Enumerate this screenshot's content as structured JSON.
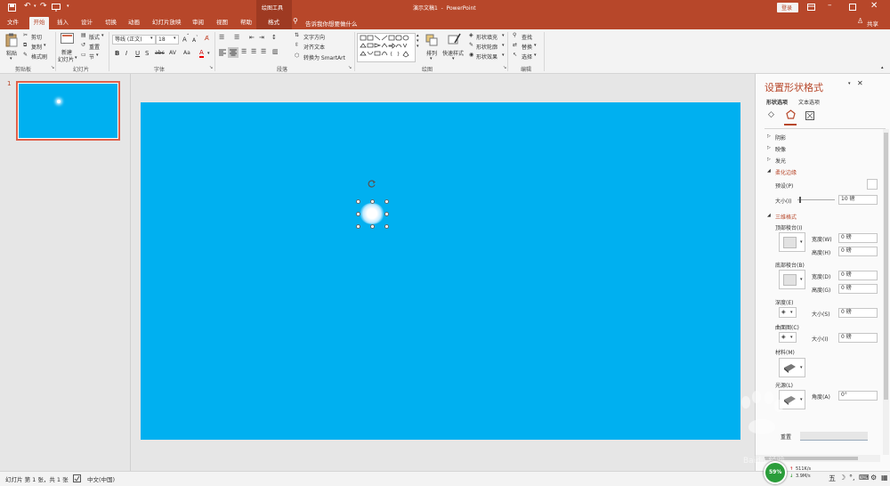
{
  "title_bar": {
    "contextual_tab_group": "绘图工具",
    "document_title": "演示文稿1  -  PowerPoint",
    "login_button": "登录"
  },
  "tabs": [
    {
      "label": "文件"
    },
    {
      "label": "开始"
    },
    {
      "label": "插入"
    },
    {
      "label": "设计"
    },
    {
      "label": "切换"
    },
    {
      "label": "动画"
    },
    {
      "label": "幻灯片放映"
    },
    {
      "label": "审阅"
    },
    {
      "label": "视图"
    },
    {
      "label": "帮助"
    },
    {
      "label": "格式"
    }
  ],
  "tell_me": "告诉我你想要做什么",
  "share": "共享",
  "ribbon": {
    "clipboard": {
      "paste": "粘贴",
      "cut": "剪切",
      "copy": "复制",
      "format_painter": "格式刷",
      "group": "剪贴板"
    },
    "slides": {
      "new_slide": "新建",
      "new_slide2": "幻灯片",
      "layout": "版式",
      "reset": "重置",
      "section": "节",
      "group": "幻灯片"
    },
    "font": {
      "font_name": "等线 (正文)",
      "font_size": "18",
      "bold": "B",
      "italic": "I",
      "underline": "U",
      "shadow": "S",
      "strike": "abc",
      "spacing": "AV",
      "case": "Aa",
      "group": "字体"
    },
    "paragraph": {
      "text_direction": "文字方向",
      "align_text": "对齐文本",
      "smartart": "转换为 SmartArt",
      "group": "段落"
    },
    "drawing": {
      "arrange": "排列",
      "quick_styles": "快速样式",
      "shape_fill": "形状填充",
      "shape_outline": "形状轮廓",
      "shape_effects": "形状效果",
      "group": "绘图"
    },
    "editing": {
      "find": "查找",
      "replace": "替换",
      "select": "选择",
      "group": "编辑"
    }
  },
  "thumbnail": {
    "number": "1"
  },
  "format_pane": {
    "title": "设置形状格式",
    "tab_shape": "形状选项",
    "tab_text": "文本选项",
    "sections": {
      "shadow": "阴影",
      "reflection": "映像",
      "glow": "发光",
      "soft_edges": "柔化边缘",
      "three_d": "三维格式"
    },
    "soft_edges": {
      "preset": "预设(P)",
      "size": "大小(I)",
      "size_value": "10 磅"
    },
    "three_d": {
      "top_bevel": "顶部棱台(I)",
      "bottom_bevel": "底部棱台(B)",
      "width_w": "宽度(W)",
      "height_h": "高度(H)",
      "width_d": "宽度(D)",
      "height_g": "高度(G)",
      "width_value": "0 磅",
      "height_value": "0 磅",
      "width2_value": "0 磅",
      "height2_value": "0 磅",
      "depth": "深度(E)",
      "depth_size": "大小(S)",
      "depth_value": "0 磅",
      "contour": "曲面图(C)",
      "contour_size": "大小(I)",
      "contour_value": "0 磅",
      "material": "材料(M)",
      "lighting": "光源(L)",
      "angle": "角度(A)",
      "angle_value": "0°",
      "reset": "重置"
    }
  },
  "status_bar": {
    "slide_info": "幻灯片 第 1 张，共 1 张",
    "language": "中文(中国)",
    "cpu": "59%",
    "up_speed": "511K/s",
    "down_speed": "3.9M/s"
  },
  "watermark": "Baidu 经验",
  "colors": {
    "accent": "#b7472a",
    "slide_background": "#00b0f0",
    "selected_thumb_border": "#e0604a"
  }
}
